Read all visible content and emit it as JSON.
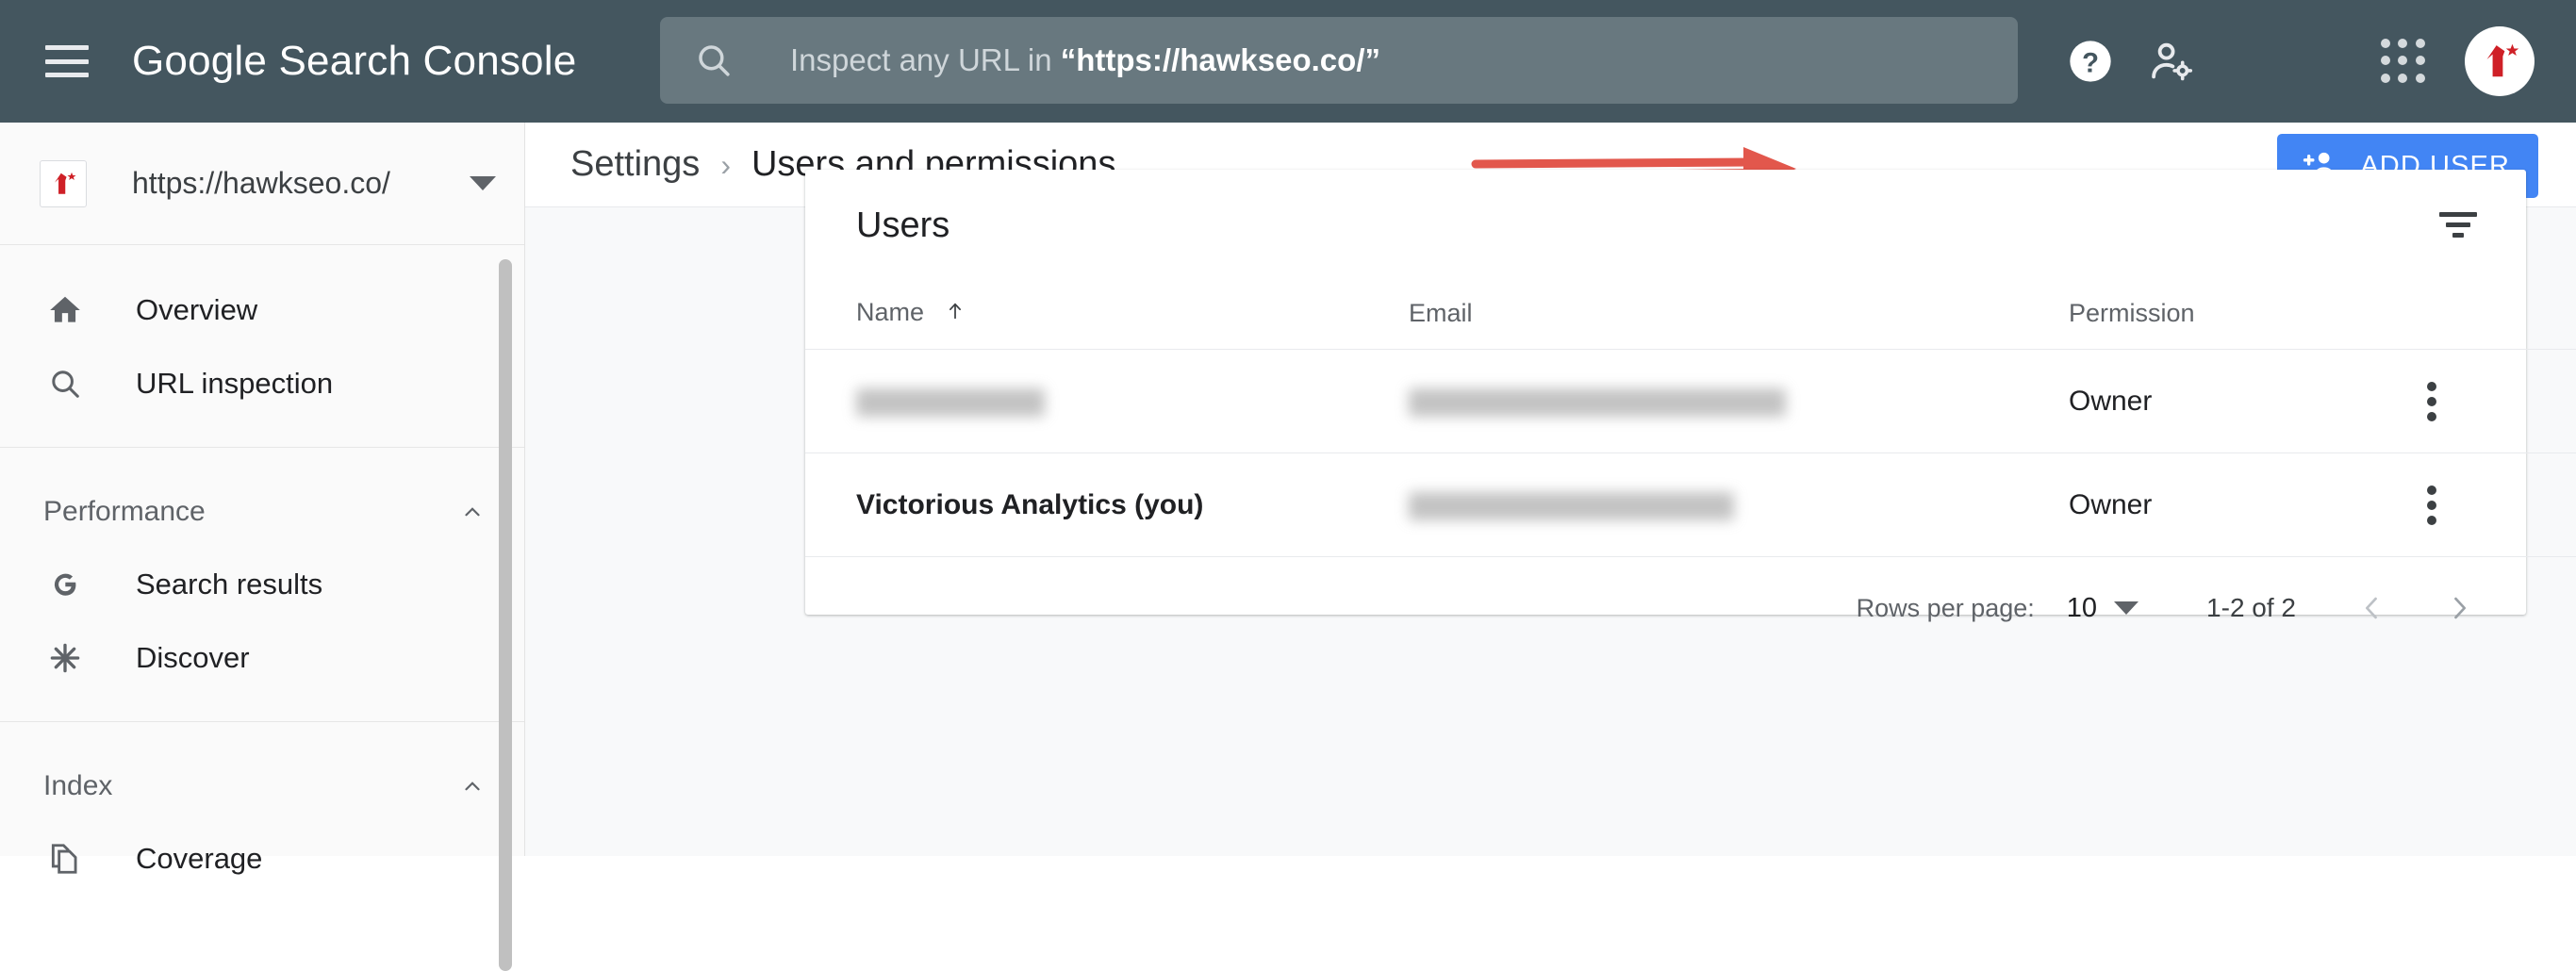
{
  "topbar": {
    "menu_icon": "hamburger-menu-icon",
    "brand": "Google Search Console",
    "search": {
      "icon": "search-icon",
      "placeholder_prefix": "Inspect any URL in ",
      "placeholder_url": "“https://hawkseo.co/”"
    },
    "help_icon": "help-question-icon",
    "account_settings_icon": "account-settings-icon",
    "apps_icon": "apps-grid-icon",
    "avatar_icon": "user-avatar-hawk-logo"
  },
  "sidebar": {
    "property": {
      "logo_icon": "property-hawk-logo-icon",
      "url": "https://hawkseo.co/",
      "caret_icon": "chevron-down-icon"
    },
    "groups": [
      {
        "label": null,
        "items": [
          {
            "icon": "home-icon",
            "label": "Overview"
          },
          {
            "icon": "search-icon",
            "label": "URL inspection"
          }
        ]
      },
      {
        "label": "Performance",
        "collapse_icon": "chevron-up-icon",
        "items": [
          {
            "icon": "google-g-icon",
            "label": "Search results"
          },
          {
            "icon": "discover-asterisk-icon",
            "label": "Discover"
          }
        ]
      },
      {
        "label": "Index",
        "collapse_icon": "chevron-up-icon",
        "items": [
          {
            "icon": "coverage-pages-icon",
            "label": "Coverage"
          }
        ]
      }
    ]
  },
  "page": {
    "breadcrumb_parent": "Settings",
    "breadcrumb_separator": "›",
    "breadcrumb_current": "Users and permissions",
    "add_user_button": {
      "label": "ADD USER",
      "icon": "add-person-icon",
      "color": "#4285f4"
    },
    "annotation": {
      "type": "arrow",
      "direction": "right",
      "color": "#e2574c",
      "points_to": "add-user-button"
    }
  },
  "users_card": {
    "title": "Users",
    "filter_icon": "filter-icon",
    "columns": [
      {
        "key": "name",
        "label": "Name",
        "sorted": "asc",
        "sort_icon": "arrow-up-icon"
      },
      {
        "key": "email",
        "label": "Email"
      },
      {
        "key": "permission",
        "label": "Permission"
      },
      {
        "key": "actions",
        "label": ""
      }
    ],
    "rows": [
      {
        "name": "",
        "name_redacted": true,
        "name_redacted_width": 120,
        "email": "",
        "email_redacted": true,
        "email_redacted_width": 250,
        "permission": "Owner",
        "is_self": false,
        "menu_icon": "more-vert-icon"
      },
      {
        "name": "Victorious Analytics (you)",
        "name_redacted": false,
        "email": "",
        "email_redacted": true,
        "email_redacted_width": 215,
        "permission": "Owner",
        "is_self": true,
        "menu_icon": "more-vert-icon"
      }
    ],
    "pagination": {
      "rows_per_page_label": "Rows per page:",
      "rows_per_page_value": "10",
      "rows_per_page_caret": "chevron-down-icon",
      "range": "1-2 of 2",
      "prev_icon": "chevron-left-icon",
      "next_icon": "chevron-right-icon"
    }
  }
}
